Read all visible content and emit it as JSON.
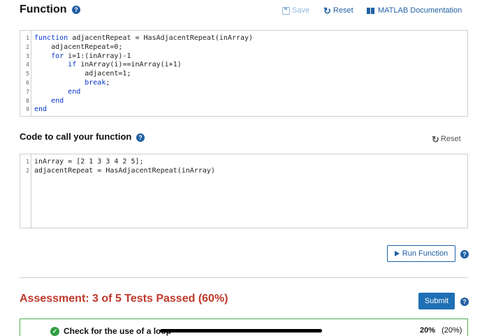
{
  "header": {
    "title": "Function",
    "help": "?",
    "save_label": "Save",
    "reset_label": "Reset",
    "docs_label": "MATLAB Documentation"
  },
  "function_editor": {
    "lines": [
      {
        "n": "1",
        "indent": "",
        "kw": "function",
        "rest": " adjacentRepeat = HasAdjacentRepeat(inArray)"
      },
      {
        "n": "2",
        "indent": "    ",
        "kw": "",
        "rest": "adjacentRepeat=0;"
      },
      {
        "n": "3",
        "indent": "    ",
        "kw": "for",
        "rest": " i=1:(inArray)-1"
      },
      {
        "n": "4",
        "indent": "        ",
        "kw": "if",
        "rest": " inArray(i)==inArray(i+1)"
      },
      {
        "n": "5",
        "indent": "            ",
        "kw": "",
        "rest": "adjacent=1;"
      },
      {
        "n": "6",
        "indent": "            ",
        "kw": "break",
        "rest": ";"
      },
      {
        "n": "7",
        "indent": "        ",
        "kw": "end",
        "rest": ""
      },
      {
        "n": "8",
        "indent": "    ",
        "kw": "end",
        "rest": ""
      },
      {
        "n": "9",
        "indent": "",
        "kw": "end",
        "rest": ""
      }
    ]
  },
  "call_section": {
    "title": "Code to call your function",
    "help": "?",
    "reset_label": "Reset",
    "lines": [
      {
        "n": "1",
        "text": "inArray = [2 1 3 3 4 2 5];"
      },
      {
        "n": "2",
        "text": "adjacentRepeat = HasAdjacentRepeat(inArray)"
      }
    ]
  },
  "run_button": {
    "label": "Run Function",
    "help": "?"
  },
  "assessment": {
    "title": "Assessment: 3 of 5 Tests Passed (60%)",
    "submit_label": "Submit",
    "help": "?"
  },
  "tests": [
    {
      "label": "Check for the use of a loop",
      "score": "20%",
      "weight": "(20%)",
      "passed": true
    }
  ],
  "colors": {
    "accent": "#1f5fa3",
    "assessment_red": "#c0392b",
    "pass_green": "#2e9d3f"
  }
}
